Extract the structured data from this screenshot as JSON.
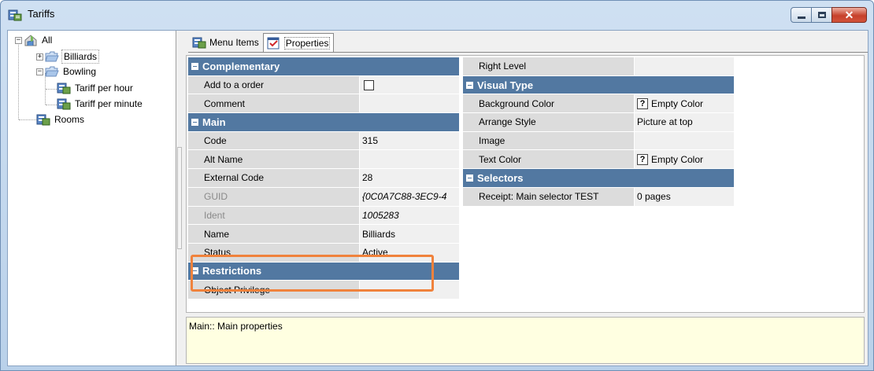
{
  "window": {
    "title": "Tariffs"
  },
  "tree": {
    "root": "All",
    "items": [
      {
        "label": "Billiards"
      },
      {
        "label": "Bowling"
      },
      {
        "label": "Tariff per hour"
      },
      {
        "label": "Tariff per minute"
      },
      {
        "label": "Rooms"
      }
    ]
  },
  "tabs": [
    {
      "label": "Menu Items"
    },
    {
      "label": "Properties"
    }
  ],
  "left_grid": {
    "complementary": {
      "title": "Complementary",
      "add_to_order": "Add to a order",
      "comment": "Comment"
    },
    "main": {
      "title": "Main",
      "code": {
        "name": "Code",
        "value": "315"
      },
      "alt_name": {
        "name": "Alt Name",
        "value": ""
      },
      "external_code": {
        "name": "External Code",
        "value": "28"
      },
      "guid": {
        "name": "GUID",
        "value": "{0C0A7C88-3EC9-4"
      },
      "ident": {
        "name": "Ident",
        "value": "1005283"
      },
      "name": {
        "name": "Name",
        "value": "Billiards"
      },
      "status": {
        "name": "Status",
        "value": "Active"
      }
    },
    "restrictions": {
      "title": "Restrictions",
      "object_privilege": "Object Privilege"
    }
  },
  "right_grid": {
    "right_level": "Right Level",
    "visual_type": {
      "title": "Visual Type",
      "background_color": {
        "name": "Background Color",
        "value": "Empty Color"
      },
      "arrange_style": {
        "name": "Arrange Style",
        "value": "Picture at top"
      },
      "image": {
        "name": "Image",
        "value": ""
      },
      "text_color": {
        "name": "Text Color",
        "value": "Empty Color"
      }
    },
    "selectors": {
      "title": "Selectors",
      "receipt": {
        "name": "Receipt: Main selector TEST",
        "value": "0 pages"
      }
    }
  },
  "description": "Main:: Main properties",
  "colors": {
    "category": "#5278a1",
    "highlight": "#f0823c",
    "desc_bg": "#ffffe1"
  }
}
